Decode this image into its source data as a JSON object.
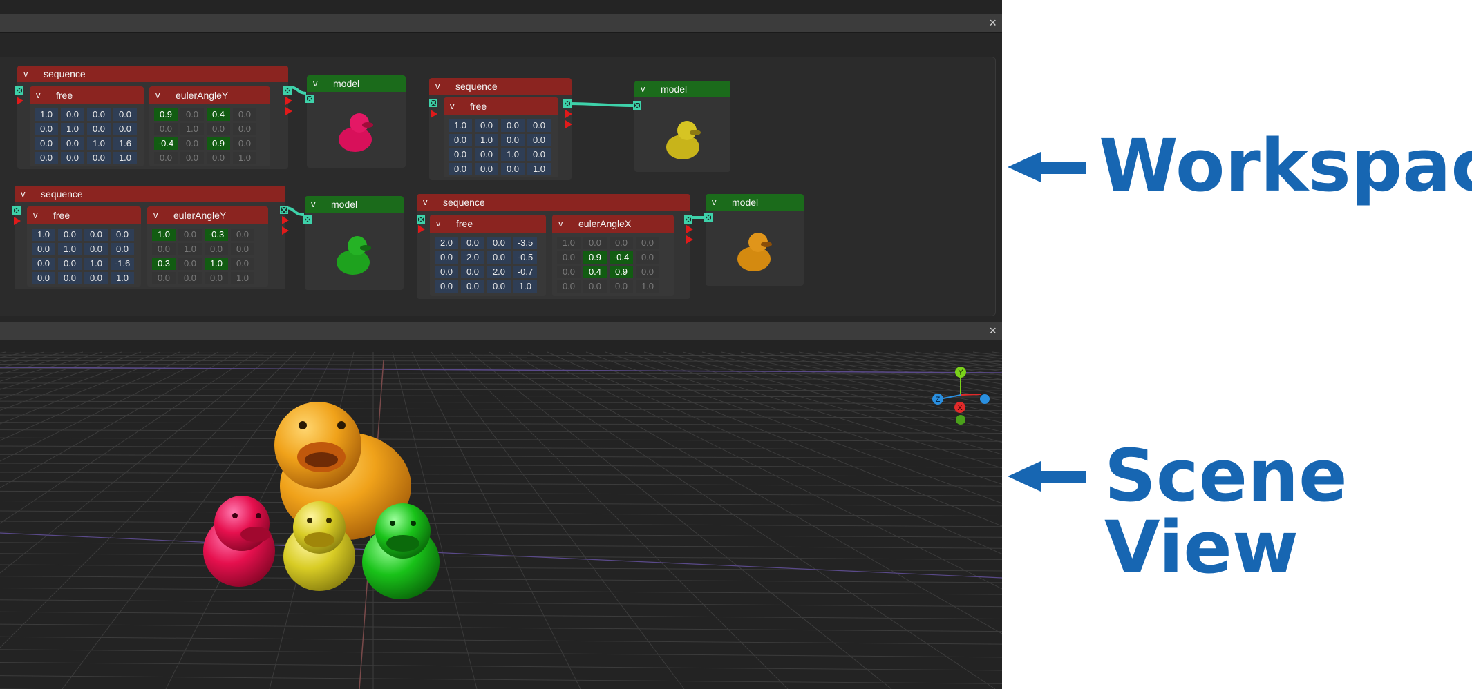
{
  "panels": {
    "workspace": {
      "close_icon": "×"
    },
    "scene": {
      "close_icon": "×"
    }
  },
  "labels": {
    "workspace": "Workspace",
    "scene_view": "Scene View"
  },
  "colors": {
    "arrow": "#1766b2",
    "node_header": "#8b2420",
    "model_header": "#1b6b1b",
    "wire": "#3ed2aa"
  },
  "nodes": {
    "g1": {
      "sequence": {
        "toggle": "v",
        "title": "sequence"
      },
      "free": {
        "toggle": "v",
        "title": "free",
        "matrix": [
          [
            "1.0",
            "0.0",
            "0.0",
            "0.0"
          ],
          [
            "0.0",
            "1.0",
            "0.0",
            "0.0"
          ],
          [
            "0.0",
            "0.0",
            "1.0",
            "1.6"
          ],
          [
            "0.0",
            "0.0",
            "0.0",
            "1.0"
          ]
        ]
      },
      "euler": {
        "toggle": "v",
        "title": "eulerAngleY",
        "matrix": [
          [
            "0.9",
            "0.0",
            "0.4",
            "0.0"
          ],
          [
            "0.0",
            "1.0",
            "0.0",
            "0.0"
          ],
          [
            "-0.4",
            "0.0",
            "0.9",
            "0.0"
          ],
          [
            "0.0",
            "0.0",
            "0.0",
            "1.0"
          ]
        ]
      },
      "model": {
        "toggle": "v",
        "title": "model",
        "duck_color": "magenta"
      }
    },
    "g2": {
      "sequence": {
        "toggle": "v",
        "title": "sequence"
      },
      "free": {
        "toggle": "v",
        "title": "free",
        "matrix": [
          [
            "1.0",
            "0.0",
            "0.0",
            "0.0"
          ],
          [
            "0.0",
            "1.0",
            "0.0",
            "0.0"
          ],
          [
            "0.0",
            "0.0",
            "1.0",
            "0.0"
          ],
          [
            "0.0",
            "0.0",
            "0.0",
            "1.0"
          ]
        ]
      },
      "model": {
        "toggle": "v",
        "title": "model",
        "duck_color": "yellow"
      }
    },
    "g3": {
      "sequence": {
        "toggle": "v",
        "title": "sequence"
      },
      "free": {
        "toggle": "v",
        "title": "free",
        "matrix": [
          [
            "1.0",
            "0.0",
            "0.0",
            "0.0"
          ],
          [
            "0.0",
            "1.0",
            "0.0",
            "0.0"
          ],
          [
            "0.0",
            "0.0",
            "1.0",
            "-1.6"
          ],
          [
            "0.0",
            "0.0",
            "0.0",
            "1.0"
          ]
        ]
      },
      "euler": {
        "toggle": "v",
        "title": "eulerAngleY",
        "matrix": [
          [
            "1.0",
            "0.0",
            "-0.3",
            "0.0"
          ],
          [
            "0.0",
            "1.0",
            "0.0",
            "0.0"
          ],
          [
            "0.3",
            "0.0",
            "1.0",
            "0.0"
          ],
          [
            "0.0",
            "0.0",
            "0.0",
            "1.0"
          ]
        ]
      },
      "model": {
        "toggle": "v",
        "title": "model",
        "duck_color": "green"
      }
    },
    "g4": {
      "sequence": {
        "toggle": "v",
        "title": "sequence"
      },
      "free": {
        "toggle": "v",
        "title": "free",
        "matrix": [
          [
            "2.0",
            "0.0",
            "0.0",
            "-3.5"
          ],
          [
            "0.0",
            "2.0",
            "0.0",
            "-0.5"
          ],
          [
            "0.0",
            "0.0",
            "2.0",
            "-0.7"
          ],
          [
            "0.0",
            "0.0",
            "0.0",
            "1.0"
          ]
        ]
      },
      "euler": {
        "toggle": "v",
        "title": "eulerAngleX",
        "matrix": [
          [
            "1.0",
            "0.0",
            "0.0",
            "0.0"
          ],
          [
            "0.0",
            "0.9",
            "-0.4",
            "0.0"
          ],
          [
            "0.0",
            "0.4",
            "0.9",
            "0.0"
          ],
          [
            "0.0",
            "0.0",
            "0.0",
            "1.0"
          ]
        ]
      },
      "model": {
        "toggle": "v",
        "title": "model",
        "duck_color": "orange"
      }
    }
  },
  "gizmo": {
    "y": "Y",
    "z": "Z",
    "x": "X"
  }
}
